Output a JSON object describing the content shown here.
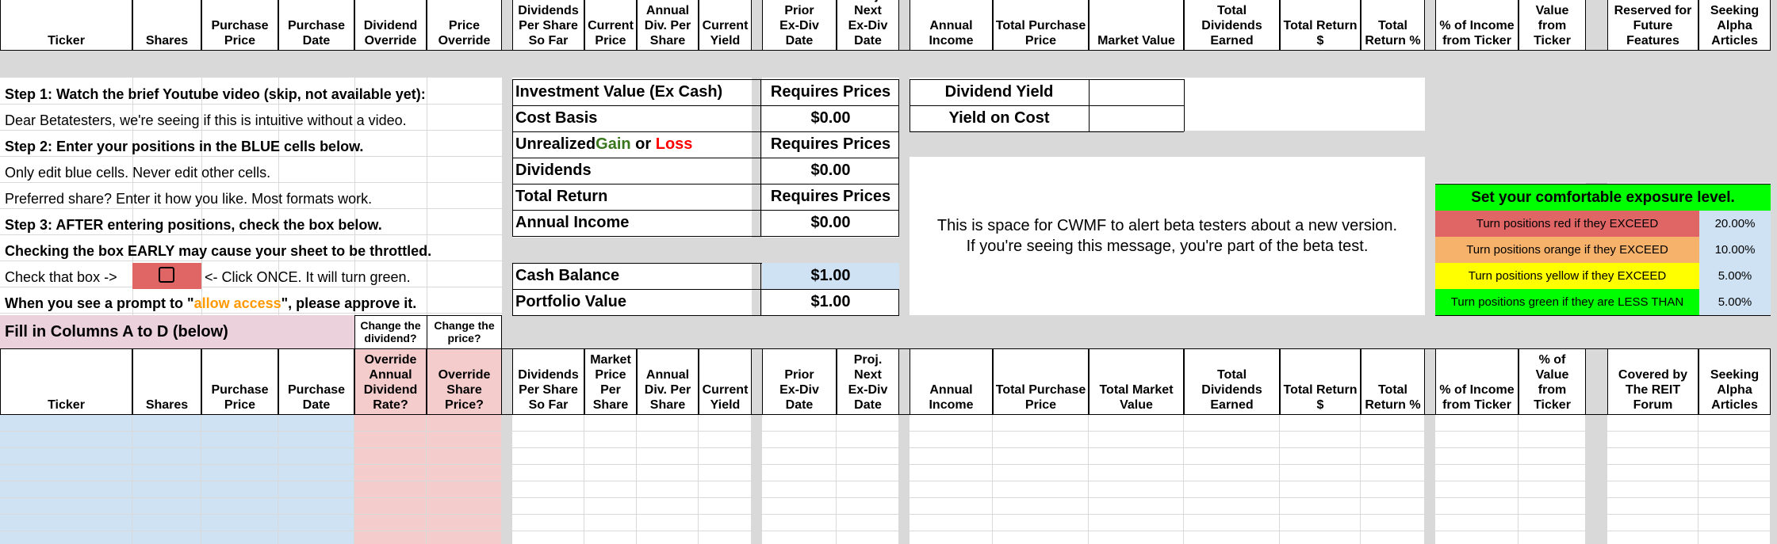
{
  "top_headers": [
    {
      "label": "Ticker"
    },
    {
      "label": "Shares"
    },
    {
      "label": "Purchase\nPrice"
    },
    {
      "label": "Purchase\nDate"
    },
    {
      "label": "Dividend\nOverride"
    },
    {
      "label": "Price\nOverride"
    },
    {
      "label": "Dividends\nPer Share\nSo Far"
    },
    {
      "label": "Current\nPrice"
    },
    {
      "label": "Annual\nDiv. Per\nShare"
    },
    {
      "label": "Current\nYield"
    },
    {
      "label": "Prior\nEx-Div\nDate"
    },
    {
      "label": "Proj. Next\nEx-Div\nDate"
    },
    {
      "label": "Annual\nIncome"
    },
    {
      "label": "Total Purchase\nPrice"
    },
    {
      "label": "Market Value"
    },
    {
      "label": "Total\nDividends\nEarned"
    },
    {
      "label": "Total Return\n$"
    },
    {
      "label": "Total\nReturn %"
    },
    {
      "label": "% of Income\nfrom Ticker"
    },
    {
      "label": "% of Value\nfrom Ticker"
    },
    {
      "label": "Reserved for\nFuture\nFeatures"
    },
    {
      "label": "Seeking\nAlpha\nArticles"
    }
  ],
  "bottom_headers": [
    {
      "label": "Ticker"
    },
    {
      "label": "Shares"
    },
    {
      "label": "Purchase\nPrice"
    },
    {
      "label": "Purchase\nDate"
    },
    {
      "label": "Override\nAnnual\nDividend\nRate?"
    },
    {
      "label": "Override\nShare\nPrice?"
    },
    {
      "label": "Dividends\nPer Share\nSo Far"
    },
    {
      "label": "Market\nPrice\nPer\nShare"
    },
    {
      "label": "Annual\nDiv. Per\nShare"
    },
    {
      "label": "Current\nYield"
    },
    {
      "label": "Prior\nEx-Div\nDate"
    },
    {
      "label": "Proj. Next\nEx-Div\nDate"
    },
    {
      "label": "Annual\nIncome"
    },
    {
      "label": "Total Purchase\nPrice"
    },
    {
      "label": "Total Market\nValue"
    },
    {
      "label": "Total\nDividends\nEarned"
    },
    {
      "label": "Total Return\n$"
    },
    {
      "label": "Total\nReturn %"
    },
    {
      "label": "% of Income\nfrom Ticker"
    },
    {
      "label": "% of Value\nfrom Ticker"
    },
    {
      "label": "Covered by\nThe REIT\nForum"
    },
    {
      "label": "Seeking\nAlpha\nArticles"
    }
  ],
  "instructions": {
    "step1": "Step 1: Watch the brief Youtube video (skip, not available yet):",
    "line2": "Dear Betatesters, we're seeing if this is intuitive without a video.",
    "step2": "Step 2: Enter your positions in the BLUE cells below.",
    "line4": "Only edit blue cells. Never edit other cells.",
    "line5": "Preferred share? Enter it how you like. Most formats work.",
    "step3": "Step 3: AFTER entering positions, check the box below.",
    "line7_pre": "Checking the box ",
    "line7_bold": "EARLY",
    "line7_post": " may cause your sheet to be throttled.",
    "checkbox_prefix": "Check that box ->",
    "checkbox_suffix": "<- Click ONCE. It will turn green.",
    "prompt_pre": "When you see a prompt to \"",
    "prompt_highlight": "allow access",
    "prompt_post": "\", please approve it."
  },
  "summary": {
    "investment_label": "Investment Value (Ex Cash)",
    "investment_value": "Requires Prices",
    "cost_basis_label": "Cost Basis",
    "cost_basis_value": "$0.00",
    "unrealized_pre": "Unrealized ",
    "unrealized_gain": "Gain",
    "unrealized_or": " or ",
    "unrealized_loss": "Loss",
    "unrealized_value": "Requires Prices",
    "dividends_label": "Dividends",
    "dividends_value": "$0.00",
    "total_return_label": "Total Return",
    "total_return_value": "Requires Prices",
    "annual_income_label": "Annual Income",
    "annual_income_value": "$0.00",
    "cash_label": "Cash Balance",
    "cash_value": "$1.00",
    "portfolio_label": "Portfolio Value",
    "portfolio_value": "$1.00"
  },
  "yield_box": {
    "dividend_yield_label": "Dividend Yield",
    "dividend_yield_value": "",
    "yield_on_cost_label": "Yield on Cost",
    "yield_on_cost_value": ""
  },
  "notice": {
    "line1": "This is space for CWMF to alert beta testers about a new version.",
    "line2": "If you're seeing this message, you're part of the beta test."
  },
  "exposure": {
    "title": "Set your comfortable exposure level.",
    "rows": [
      {
        "label": "Turn positions red if they EXCEED",
        "value": "20.00%",
        "color": "#e06666"
      },
      {
        "label": "Turn positions orange if they EXCEED",
        "value": "10.00%",
        "color": "#f6b26b"
      },
      {
        "label": "Turn positions yellow if they EXCEED",
        "value": "5.00%",
        "color": "#ffff00"
      },
      {
        "label": "Turn positions green if they are LESS THAN",
        "value": "5.00%",
        "color": "#00ff00"
      }
    ]
  },
  "fill_section": {
    "title": "Fill in Columns A to D (below)",
    "dividend_q": "Change the\ndividend?",
    "price_q": "Change the\nprice?"
  },
  "colors": {
    "input_blue": "#cfe2f3",
    "override_pink": "#f4cccc",
    "fill_pink": "#ead1dc",
    "checkbox_red": "#e06666",
    "gain_green": "#38761d",
    "loss_red": "#ff0000",
    "allow_orange": "#ff9900",
    "exposure_green": "#00ff00",
    "gray": "#d9d9d9"
  }
}
